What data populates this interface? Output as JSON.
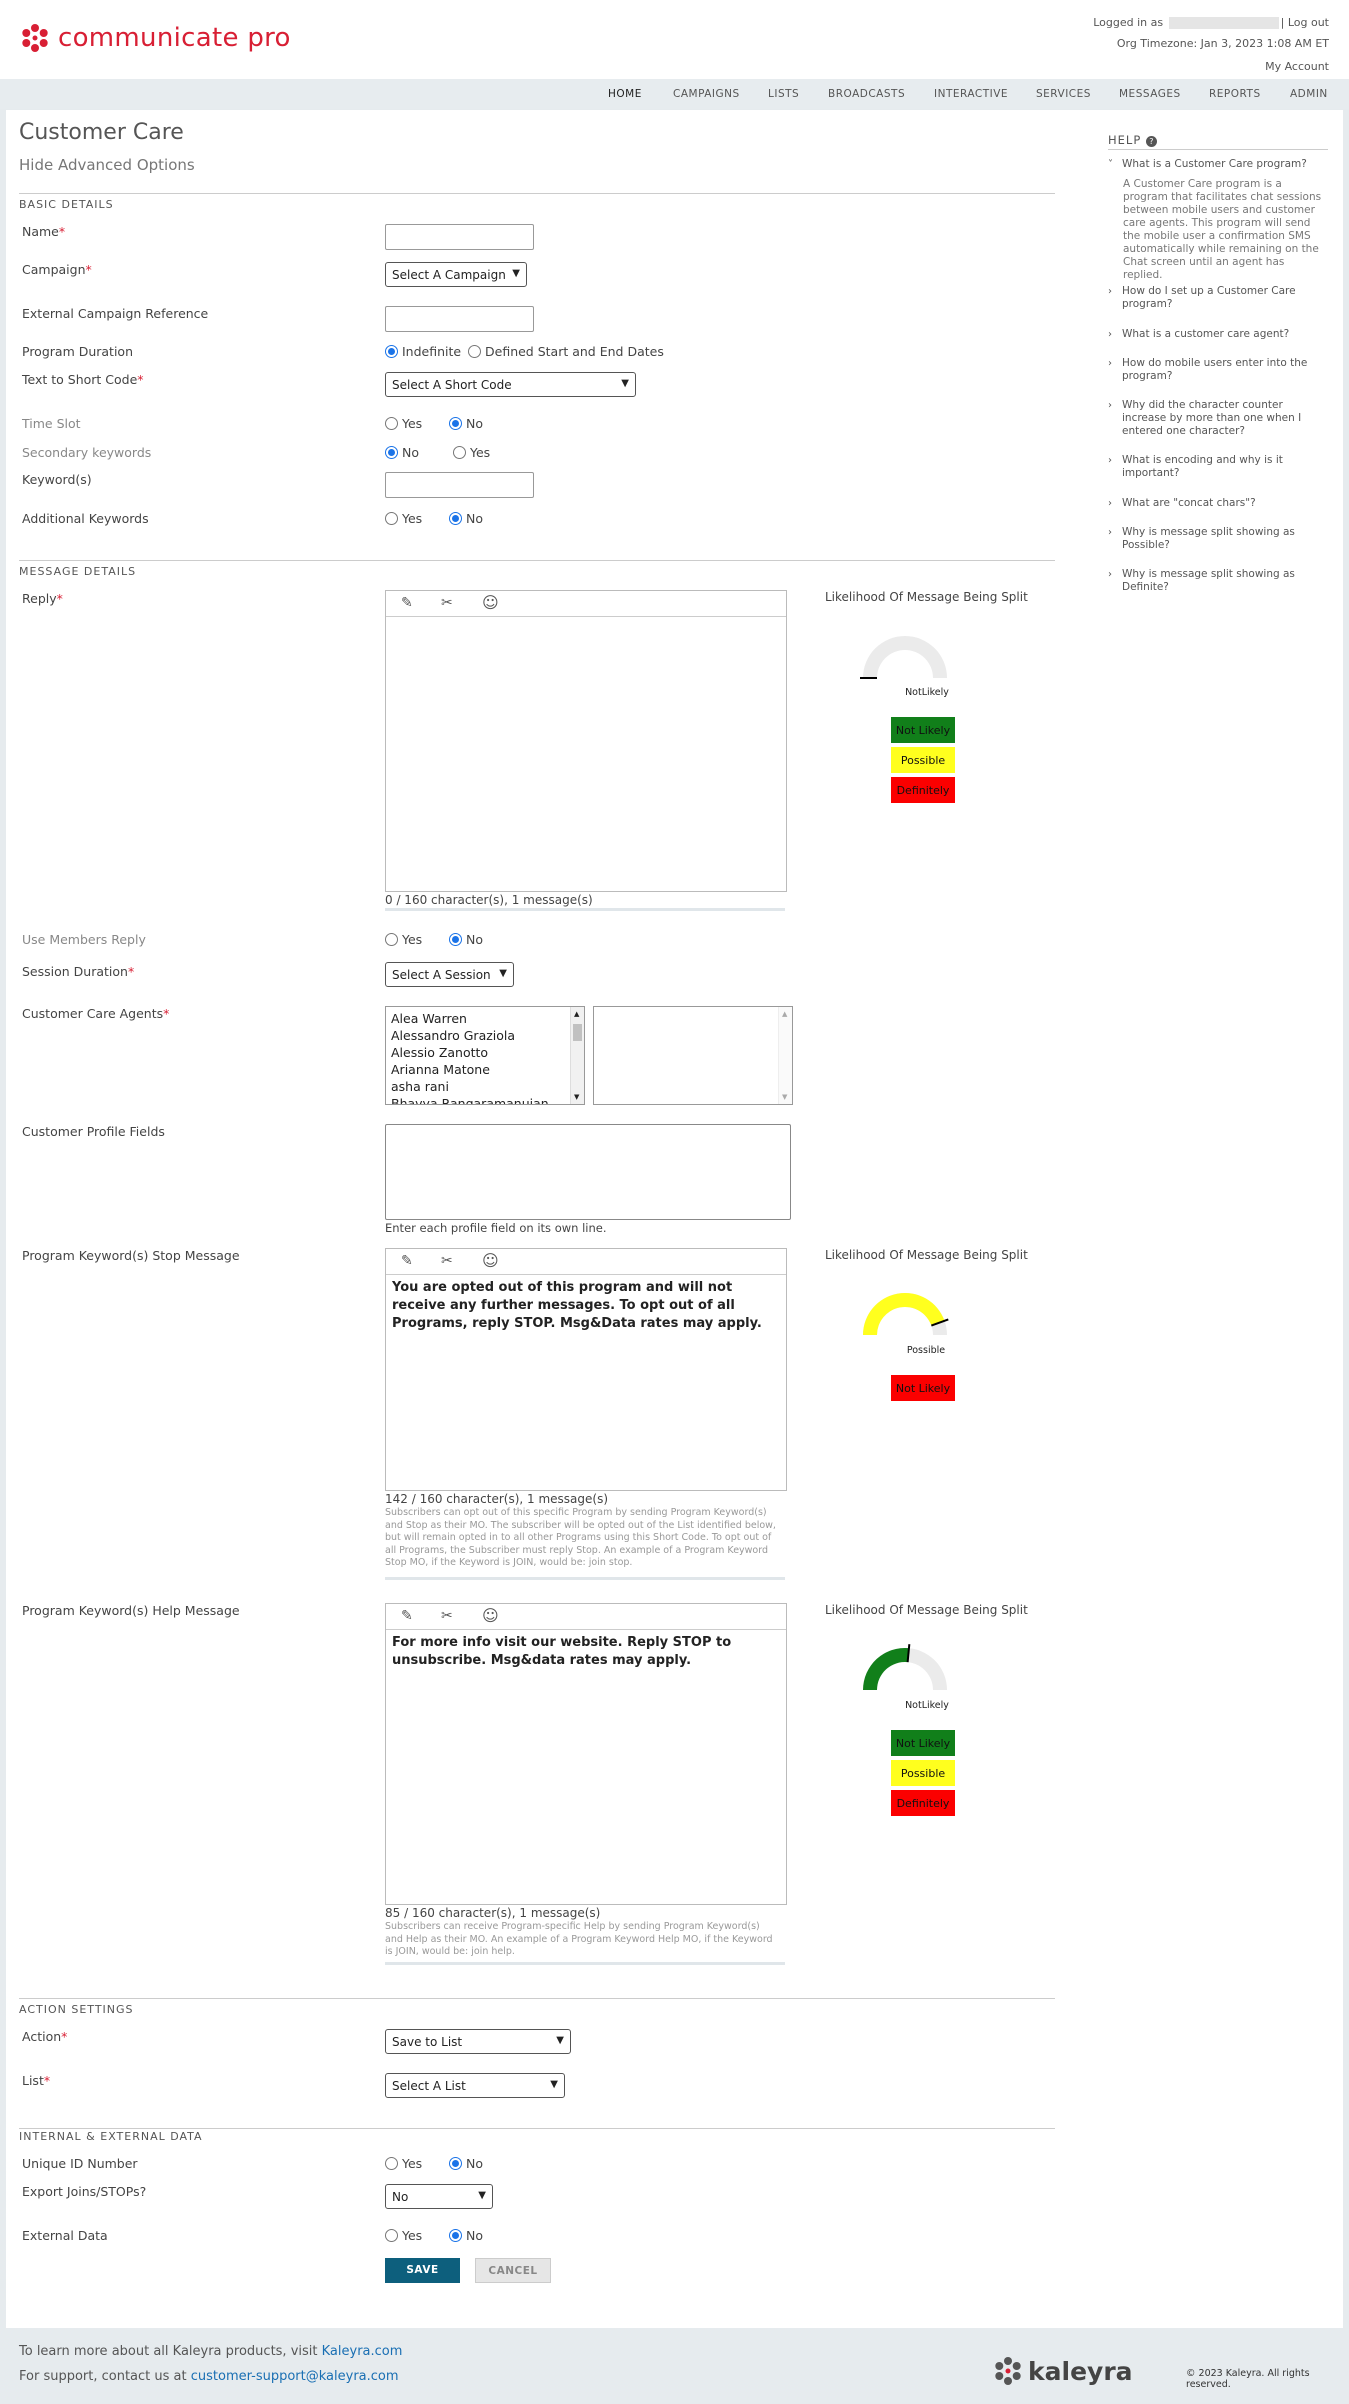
{
  "brand": {
    "name": "communicate pro"
  },
  "topright": {
    "logged_in": "Logged in as",
    "logout": "Log out",
    "timezone": "Org Timezone: Jan 3, 2023 1:08 AM ET",
    "my_account": "My Account"
  },
  "nav": [
    "HOME",
    "CAMPAIGNS",
    "LISTS",
    "BROADCASTS",
    "INTERACTIVE",
    "SERVICES",
    "MESSAGES",
    "REPORTS",
    "ADMIN"
  ],
  "page": {
    "title": "Customer Care",
    "hide_advanced": "Hide Advanced Options"
  },
  "basic": {
    "section": "BASIC DETAILS",
    "name": "Name",
    "campaign": "Campaign",
    "campaign_select": "Select A Campaign",
    "ext_ref": "External Campaign Reference",
    "duration": "Program Duration",
    "indefinite": "Indefinite",
    "defined": "Defined Start and End Dates",
    "text_to": "Text to Short Code",
    "shortcode_select": "Select A Short Code",
    "timeslot": "Time Slot",
    "secondary": "Secondary keywords",
    "keywords": "Keyword(s)",
    "additional": "Additional Keywords",
    "yes": "Yes",
    "no": "No"
  },
  "message": {
    "section": "MESSAGE DETAILS",
    "reply": "Reply",
    "likelihood": "Likelihood Of Message Being Split",
    "reply_counter": "0 / 160 character(s), 1 message(s)",
    "not_likely": "Not Likely",
    "possible": "Possible",
    "definitely": "Definitely",
    "notlikely_gauge": "NotLikely",
    "use_members": "Use Members Reply",
    "session": "Session Duration",
    "session_select": "Select A Session",
    "agents": "Customer Care Agents",
    "agent_list": [
      "Alea Warren",
      "Alessandro Graziola",
      "Alessio Zanotto",
      "Arianna Matone",
      "asha rani",
      "Bhavya Rangaramanujan"
    ],
    "profile": "Customer Profile Fields",
    "profile_hint": "Enter each profile field on its own line.",
    "stop": "Program Keyword(s) Stop Message",
    "stop_text": "You are opted out of this program and will not receive any further messages. To opt out of all Programs, reply STOP. Msg&Data rates may apply.",
    "stop_counter": "142 / 160 character(s), 1 message(s)",
    "stop_note": "Subscribers can opt out of this specific Program by sending Program Keyword(s) and Stop as their MO. The subscriber will be opted out of the List identified below, but will remain opted in to all other Programs using this Short Code. To opt out of all Programs, the Subscriber must reply Stop. An example of a Program Keyword Stop MO, if the Keyword is JOIN, would be: join stop.",
    "help": "Program Keyword(s) Help Message",
    "help_text": "For more info visit our website. Reply STOP to unsubscribe. Msg&data rates may apply.",
    "help_counter": "85 / 160 character(s), 1 message(s)",
    "help_note": "Subscribers can receive Program-specific Help by sending Program Keyword(s) and Help as their MO. An example of a Program Keyword Help MO, if the Keyword is JOIN, would be: join help."
  },
  "action": {
    "section": "ACTION SETTINGS",
    "action": "Action",
    "action_select": "Save to List",
    "list": "List",
    "list_select": "Select A List"
  },
  "internal": {
    "section": "INTERNAL & EXTERNAL DATA",
    "unique": "Unique ID Number",
    "export": "Export Joins/STOPs?",
    "export_select": "No",
    "external": "External Data"
  },
  "buttons": {
    "save": "SAVE",
    "cancel": "CANCEL"
  },
  "helpcol": {
    "heading": "HELP",
    "q1": "What is a Customer Care program?",
    "a1": "A Customer Care program is a program that facilitates chat sessions between mobile users and customer care agents. This program will send the mobile user a confirmation SMS automatically while remaining on the Chat screen until an agent has replied.",
    "q2": "How do I set up a Customer Care program?",
    "q3": "What is a customer care agent?",
    "q4": "How do mobile users enter into the program?",
    "q5": "Why did the character counter increase by more than one when I entered one character?",
    "q6": "What is encoding and why is it important?",
    "q7": "What are \"concat chars\"?",
    "q8": "Why is message split showing as Possible?",
    "q9": "Why is message split showing as Definite?"
  },
  "footer": {
    "line1": "To learn more about all Kaleyra products, visit",
    "link1": "Kaleyra.com",
    "line2": "For support, contact us at",
    "link2": "customer-support@kaleyra.com",
    "brand": "kaleyra",
    "copyright": "© 2023 Kaleyra. All rights reserved."
  },
  "colors": {
    "brand_red": "#d81f34",
    "save_button": "#0d5f7d",
    "gauge_yellow": "#ffff1e",
    "gauge_green": "#117f1a",
    "not_likely": "#117f1a",
    "possible": "#ffff1e",
    "definitely": "#fb0000"
  },
  "gauges": {
    "reply": 0.0,
    "stop": 0.89,
    "help": 0.53
  }
}
